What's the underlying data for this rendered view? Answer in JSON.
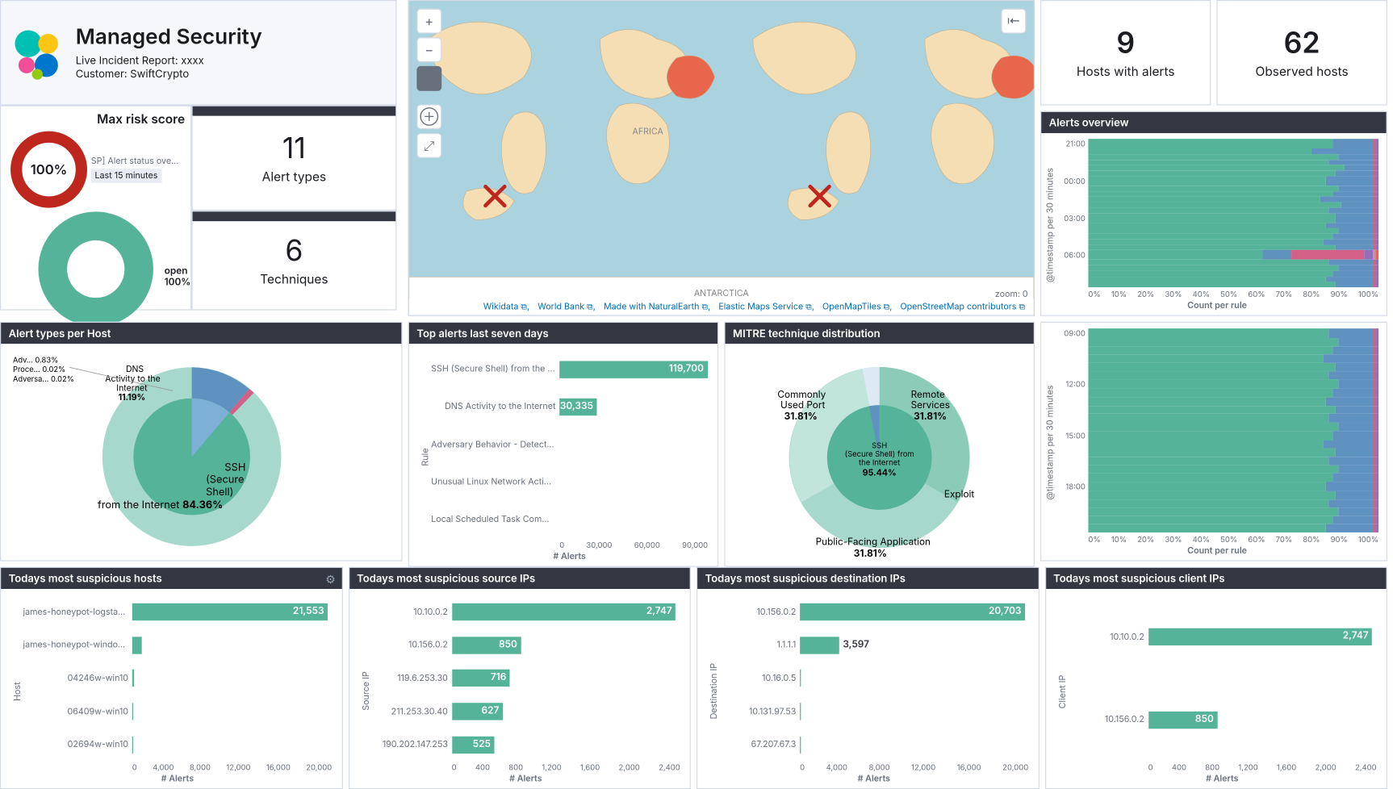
{
  "header": {
    "title": "Managed Security",
    "report_line": "Live Incident Report: xxxx",
    "customer_line": "Customer: SwiftCrypto"
  },
  "stats": {
    "alert_types": {
      "value": "11",
      "label": "Alert types"
    },
    "techniques": {
      "value": "6",
      "label": "Techniques"
    },
    "hosts_with_alerts": {
      "value": "9",
      "label": "Hosts with alerts"
    },
    "observed_hosts": {
      "value": "62",
      "label": "Observed hosts"
    }
  },
  "risk": {
    "title": "Max risk score",
    "gauge_value": "100%",
    "sub1": "SP] Alert status ove...",
    "sub2": "Last 15 minutes",
    "status_title": "Alert status",
    "donut_label": "open\n100%"
  },
  "map": {
    "zoom_label": "zoom: 0",
    "attributions": [
      "Wikidata",
      "World Bank",
      "Made with NaturalEarth",
      "Elastic Maps Service",
      "OpenMapTiles",
      "OpenStreetMap contributors"
    ]
  },
  "panels": {
    "alert_types_host": "Alert types per Host",
    "top_alerts": "Top alerts last seven days",
    "mitre": "MITRE technique distribution",
    "alerts_overview": "Alerts overview",
    "susp_hosts": "Todays most suspicious hosts",
    "susp_src": "Todays most suspicious source IPs",
    "susp_dst": "Todays most suspicious destination IPs",
    "susp_client": "Todays most suspicious client IPs"
  },
  "chart_data": {
    "alert_types_per_host": {
      "type": "pie",
      "slices": [
        {
          "label": "SSH (Secure Shell) from the Internet",
          "pct": 84.36,
          "color": "#54b399"
        },
        {
          "label": "DNS Activity to the Internet",
          "pct": 11.19,
          "color": "#6092c0"
        },
        {
          "label": "Adv...",
          "pct": 0.83,
          "color": "#d36086"
        },
        {
          "label": "Proce...",
          "pct": 0.02,
          "color": "#9170b8"
        },
        {
          "label": "Adversa...",
          "pct": 0.02,
          "color": "#ca8eae"
        }
      ]
    },
    "top_alerts_seven_days": {
      "type": "bar",
      "orientation": "horizontal",
      "ylabel": "Rule",
      "xlabel": "# Alerts",
      "xticks": [
        "0",
        "30,000",
        "60,000",
        "90,000"
      ],
      "max": 120000,
      "rows": [
        {
          "cat": "SSH (Secure Shell) from the Internet",
          "val": 119700,
          "disp": "119,700"
        },
        {
          "cat": "DNS Activity to the Internet",
          "val": 30335,
          "disp": "30,335"
        },
        {
          "cat": "Adversary Behavior - Detected - Endpoint Security",
          "val": 0,
          "disp": ""
        },
        {
          "cat": "Unusual Linux Network Activity",
          "val": 0,
          "disp": ""
        },
        {
          "cat": "Local Scheduled Task Commands",
          "val": 0,
          "disp": ""
        }
      ]
    },
    "mitre_distribution": {
      "type": "pie",
      "inner": {
        "label": "SSH (Secure Shell) from the Internet",
        "pct": 95.44
      },
      "outer": [
        {
          "label": "Remote Services",
          "pct": 31.81
        },
        {
          "label": "Exploit Public-Facing Application",
          "pct": 31.81
        },
        {
          "label": "Commonly Used Port",
          "pct": 31.81
        }
      ]
    },
    "alerts_overview": {
      "type": "bar",
      "orientation": "horizontal",
      "stacked_pct": true,
      "ylabel": "@timestamp per 30 minutes",
      "xlabel": "Count per rule",
      "xticks": [
        "0%",
        "10%",
        "20%",
        "30%",
        "40%",
        "50%",
        "60%",
        "70%",
        "80%",
        "90%",
        "100%"
      ],
      "time_labels": [
        "21:00",
        "",
        "",
        "",
        "",
        "",
        "00:00",
        "",
        "",
        "",
        "",
        "",
        "03:00",
        "",
        "",
        "",
        "",
        "",
        "06:00",
        "",
        "",
        "",
        "",
        "",
        "09:00",
        "",
        "",
        "",
        "",
        "",
        "12:00",
        "",
        "",
        "",
        "",
        "",
        "15:00",
        "",
        "",
        "",
        "",
        "",
        "18:00",
        "",
        "",
        "",
        "",
        ""
      ],
      "series_colors": [
        "#54b399",
        "#6092c0",
        "#d36086",
        "#9170b8",
        "#ca8eae",
        "#e7664c"
      ],
      "rows": [
        [
          84,
          14,
          1,
          1,
          0,
          0
        ],
        [
          77,
          21,
          1,
          1,
          0,
          0
        ],
        [
          86,
          12,
          1,
          1,
          0,
          0
        ],
        [
          83,
          15,
          1,
          1,
          0,
          0
        ],
        [
          88,
          10,
          1,
          1,
          0,
          0
        ],
        [
          85,
          13,
          1,
          1,
          0,
          0
        ],
        [
          82,
          16,
          1,
          1,
          0,
          0
        ],
        [
          86,
          12,
          1,
          1,
          0,
          0
        ],
        [
          84,
          14,
          1,
          1,
          0,
          0
        ],
        [
          80,
          18,
          1,
          1,
          0,
          0
        ],
        [
          87,
          11,
          1,
          1,
          0,
          0
        ],
        [
          83,
          15,
          1,
          1,
          0,
          0
        ],
        [
          85,
          13,
          1,
          1,
          0,
          0
        ],
        [
          82,
          16,
          1,
          1,
          0,
          0
        ],
        [
          86,
          12,
          1,
          1,
          0,
          0
        ],
        [
          84,
          14,
          1,
          1,
          0,
          0
        ],
        [
          81,
          17,
          1,
          1,
          0,
          0
        ],
        [
          85,
          13,
          1,
          1,
          0,
          0
        ],
        [
          60,
          10,
          25,
          3,
          1,
          1
        ],
        [
          83,
          15,
          1,
          1,
          0,
          0
        ],
        [
          86,
          12,
          1,
          1,
          0,
          0
        ],
        [
          84,
          14,
          1,
          1,
          0,
          0
        ],
        [
          82,
          16,
          1,
          1,
          0,
          0
        ],
        [
          85,
          13,
          1,
          1,
          0,
          0
        ],
        [
          83,
          15,
          1,
          1,
          0,
          0
        ],
        [
          86,
          12,
          1,
          1,
          0,
          0
        ],
        [
          84,
          14,
          1,
          1,
          0,
          0
        ],
        [
          81,
          17,
          1,
          1,
          0,
          0
        ],
        [
          85,
          13,
          1,
          1,
          0,
          0
        ],
        [
          83,
          15,
          1,
          1,
          0,
          0
        ],
        [
          86,
          12,
          1,
          1,
          0,
          0
        ],
        [
          84,
          14,
          1,
          1,
          0,
          0
        ],
        [
          82,
          16,
          1,
          1,
          0,
          0
        ],
        [
          85,
          13,
          1,
          1,
          0,
          0
        ],
        [
          83,
          15,
          1,
          1,
          0,
          0
        ],
        [
          86,
          12,
          1,
          1,
          0,
          0
        ],
        [
          84,
          14,
          1,
          1,
          0,
          0
        ],
        [
          81,
          17,
          1,
          1,
          0,
          0
        ],
        [
          85,
          13,
          1,
          1,
          0,
          0
        ],
        [
          83,
          15,
          1,
          1,
          0,
          0
        ],
        [
          86,
          12,
          1,
          1,
          0,
          0
        ],
        [
          84,
          14,
          1,
          1,
          0,
          0
        ],
        [
          82,
          16,
          1,
          1,
          0,
          0
        ],
        [
          85,
          13,
          1,
          1,
          0,
          0
        ],
        [
          83,
          15,
          1,
          1,
          0,
          0
        ],
        [
          86,
          12,
          1,
          1,
          0,
          0
        ],
        [
          84,
          14,
          1,
          1,
          0,
          0
        ],
        [
          82,
          16,
          1,
          1,
          0,
          0
        ]
      ]
    },
    "susp_hosts": {
      "type": "bar",
      "orientation": "horizontal",
      "ylabel": "Host",
      "xlabel": "# Alerts",
      "xticks": [
        "0",
        "4,000",
        "8,000",
        "12,000",
        "16,000",
        "20,000"
      ],
      "max": 22000,
      "rows": [
        {
          "cat": "james-honeypot-logstash-demo",
          "val": 21553,
          "disp": "21,553"
        },
        {
          "cat": "james-honeypot-windows-dirty",
          "val": 1100,
          "disp": ""
        },
        {
          "cat": "04246w-win10",
          "val": 200,
          "disp": ""
        },
        {
          "cat": "06409w-win10",
          "val": 50,
          "disp": ""
        },
        {
          "cat": "02694w-win10",
          "val": 50,
          "disp": ""
        }
      ]
    },
    "susp_src": {
      "type": "bar",
      "orientation": "horizontal",
      "ylabel": "Source IP",
      "xlabel": "# Alerts",
      "xticks": [
        "0",
        "400",
        "800",
        "1,200",
        "1,600",
        "2,000",
        "2,400"
      ],
      "max": 2800,
      "rows": [
        {
          "cat": "10.10.0.2",
          "val": 2747,
          "disp": "2,747"
        },
        {
          "cat": "10.156.0.2",
          "val": 850,
          "disp": "850"
        },
        {
          "cat": "119.6.253.30",
          "val": 716,
          "disp": "716"
        },
        {
          "cat": "211.253.30.40",
          "val": 627,
          "disp": "627"
        },
        {
          "cat": "190.202.147.253",
          "val": 525,
          "disp": "525"
        }
      ]
    },
    "susp_dst": {
      "type": "bar",
      "orientation": "horizontal",
      "ylabel": "Destination IP",
      "xlabel": "# Alerts",
      "xticks": [
        "0",
        "4,000",
        "8,000",
        "12,000",
        "16,000",
        "20,000"
      ],
      "max": 21000,
      "rows": [
        {
          "cat": "10.156.0.2",
          "val": 20703,
          "disp": "20,703"
        },
        {
          "cat": "1.1.1.1",
          "val": 3597,
          "disp": "3,597"
        },
        {
          "cat": "10.16.0.5",
          "val": 50,
          "disp": ""
        },
        {
          "cat": "10.131.97.53",
          "val": 50,
          "disp": ""
        },
        {
          "cat": "67.207.67.3",
          "val": 50,
          "disp": ""
        }
      ]
    },
    "susp_client": {
      "type": "bar",
      "orientation": "horizontal",
      "ylabel": "Client IP",
      "xlabel": "# Alerts",
      "xticks": [
        "0",
        "400",
        "800",
        "1,200",
        "1,600",
        "2,000",
        "2,400"
      ],
      "max": 2800,
      "rows": [
        {
          "cat": "10.10.0.2",
          "val": 2747,
          "disp": "2,747"
        },
        {
          "cat": "10.156.0.2",
          "val": 850,
          "disp": "850"
        }
      ]
    }
  }
}
